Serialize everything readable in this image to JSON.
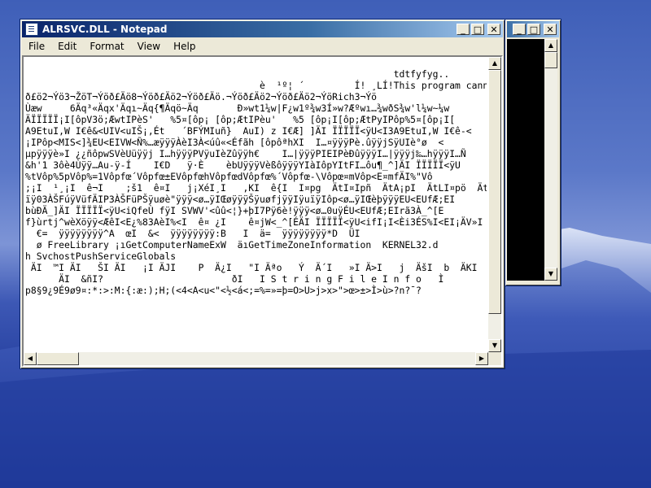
{
  "notepad": {
    "title": "ALRSVC.DLL - Notepad",
    "menu": [
      "File",
      "Edit",
      "Format",
      "View",
      "Help"
    ],
    "lines": [
      "",
      "                                                                  tdtfyfyg..",
      "                                          è  ¹º¦ ´         Í! ¸LÍ!This program cann",
      "ð£ö2¬Ýö3¬ŽöT¬Ýöð£Äö8¬Ýöð£Äö2¬Ýöð£Äö.¬Ýöð£Äö2¬Ýöð£Äö2¬ÝöRich3¬Ýö",
      "Ùæw     6Äq³«Äqx'Äqı~Äq{¶Äqö~Äq       Ð»wt1¼w|F¿w1º¾w3Í»w?Æºwı…¾wðS¾w'l¼w~¼w",
      "ÄÏÏÏÏÏ¡I[ôpV3ö;ÆwtIPèS'   %5¤[ôp¡ [ôp;ÆtIPèu'   %5 [ôp¡I[ôp;ÆtPyIPôp%5¤[ôp¡I[",
      "A9EtuI,W I€ê&<UIV<uIŠ¡,Ét   ´BFÝMIuñ}  AuI) z I€Æ] ]ÄI ÏÏÏÏÏ<ÿU<I3A9EtuI,W I€ê-<",
      "¡IPôp<MIS<]¾EU<EIVW<Ñ%…æÿÿÿÀèI3À<úû«<Éfãh [ôpôªhXI  I…¤ÿÿÿPè.ûÿÿjSÿUIè°ø  <",
      "µpÿÿÿè»I ¿¿ñôpwSVèUüÿÿj I…hÿÿÿPVÿuIèZûÿÿh€    I…|ÿÿÿPIEIPèÐûÿÿÿI…|ÿÿÿj‰…hÿÿÿI…Ñ",
      "&h'1 3ôè4Ùÿÿ…Au-ÿ-Í    I€D   ÿ·È    èbUÿÿÿVèßôÿÿÿYIàIôpYItFI…ôu¶_^]ÄI ÏÏÏÏÏ<ÿU",
      "%tVôp%5pVôp%=1Vôpfœ´Vôpfœ±EVôpfœhVôpfœdVôpfœ%´Vôpfœ-\\Vôpœ¤mVôp<E¤mfÄI%\"Vô",
      ";¡I  ¹¸¡I  ê¬I    ;š1  ê¤I   j¡XéI¸I   ,KI  ê{I  I¤pg  ÄtI¤Ipñ  ÄtA¡pI  ÄtLI¤pö  Ät:I¤pp  Ä",
      "ïÿ03ÀŠFúÿVüfÄIP3ÀŠFüPŠÿuøè\"ÿÿÿ<ø…ÿIŒøÿÿÿŠÿuøfjÿÿIÿuïÿIôp<ø…ÿIŒèþÿÿÿEU<EUfÆ;EI",
      "bùÐÄ_]ÄI ÏÏÏÏÏ<ÿU<iQfeÙ fÿI SVWV'<ûû<¦}+þI7Pÿ6è!ÿÿÿ<ø…0uÿÉU<EUfÆ;EIrã3À_^[E",
      "f}ùrtj^wèXöÿÿ<ÆêI<E¿%83AèI%<I  ê¤ ¿I    ê¤jW<_^[ÉÄI ÏÏÏÏÏ<ÿU<ifI¡I<Èi3ÉS%I<EI¡ÄV»I",
      "  €=  ÿÿÿÿÿÿÿÿ^A  œI  &<  ÿÿÿÿÿÿÿÿ:B   I  ä=  ÿÿÿÿÿÿÿÿ*D  ÜI",
      "  ø FreeLibrary ¡ıGetComputerNameExW  äıGetTimeZoneInformation  KERNEL32.d",
      "h SvchostPushServiceGlobals",
      " ÄI  ™I ÄI   ŠI ÄI   ¡I ÄJI    P  Ä¿I   \"I Äªo   Ý  Ä´I   »I Ä>I   j  ÄšI  b  ÄKI   #  Ä",
      "      ÄI  &ñI?                       ðI   I S t r i n g F i l e I n f o   Ì",
      "p8§9¿9É9ø9¤:*:>:M:{:æ:);H;(<4<A<u<\"<½<á<;=%=»=þ=O>U>j>x>\">œ>±>Ì>ù>?n?¯?"
    ]
  },
  "console": {}
}
